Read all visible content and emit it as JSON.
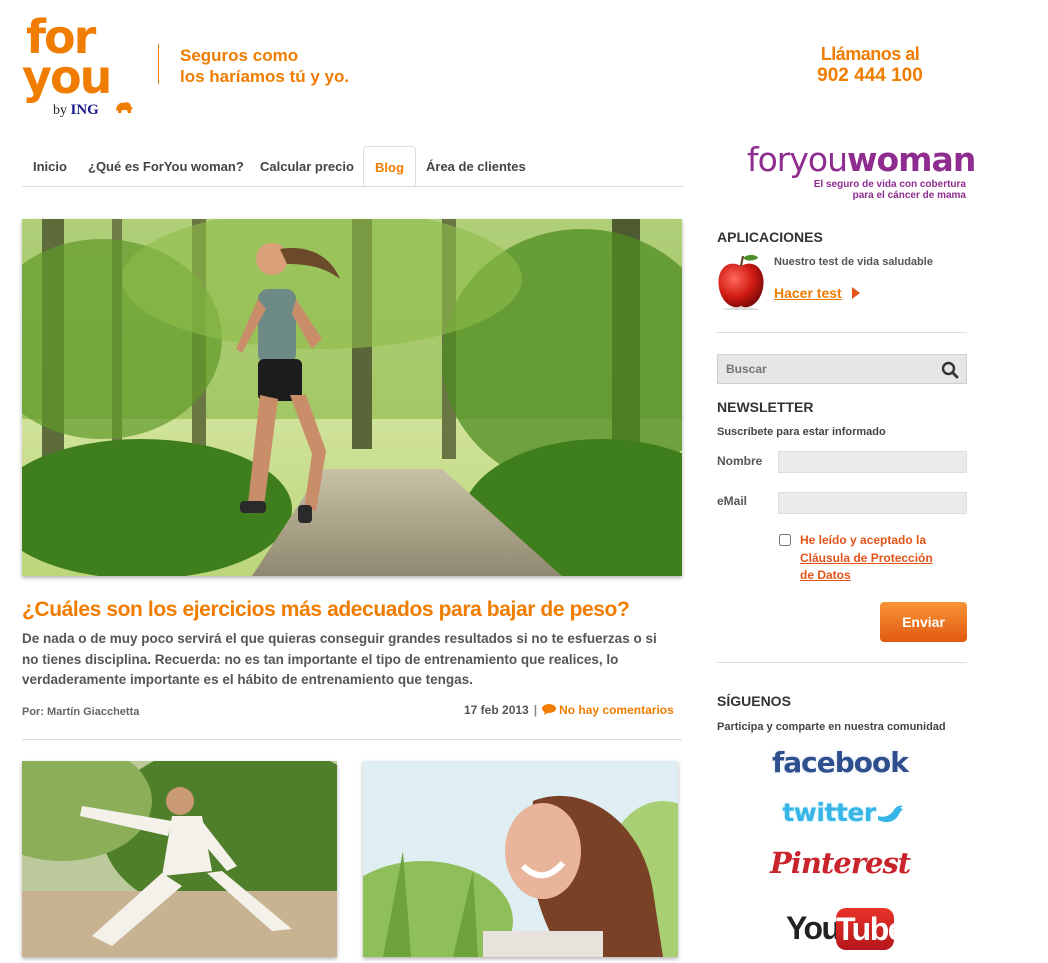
{
  "brand": {
    "logo_line1": "for",
    "logo_line2": "you",
    "logo_by": "by",
    "logo_ing": "ING",
    "tagline_line1": "Seguros como",
    "tagline_line2": "los haríamos tú y yo.",
    "call_label": "Llámanos al",
    "call_number": "902 444 100",
    "product_regular": "foryou",
    "product_bold": "woman",
    "product_sub_line1": "El seguro de vida con cobertura",
    "product_sub_line2": "para el cáncer de mama",
    "orange": "#f07c00",
    "purple": "#8e2d8f"
  },
  "nav": {
    "items": [
      {
        "label": "Inicio",
        "active": false
      },
      {
        "label": "¿Qué es ForYou woman?",
        "active": false
      },
      {
        "label": "Calcular precio",
        "active": false
      },
      {
        "label": "Blog",
        "active": true
      },
      {
        "label": "Área de clientes",
        "active": false
      }
    ]
  },
  "article": {
    "title": "¿Cuáles son los ejercicios más adecuados para bajar de peso?",
    "excerpt": "De nada o de muy poco servirá el que quieras conseguir grandes resultados si no te esfuerzas o si no tienes disciplina. Recuerda: no es tan importante el tipo de entrenamiento que realices, lo verdaderamente importante es el hábito de entrenamiento que tengas.",
    "byline": "Por: Martín Giacchetta",
    "date": "17 feb 2013",
    "separator": "|",
    "comments": "No hay comentarios",
    "image_icon": "woman-running-photo"
  },
  "thumbnails": [
    {
      "icon": "tai-chi-man-photo"
    },
    {
      "icon": "smiling-woman-photo"
    }
  ],
  "sidebar": {
    "apps_heading": "APLICACIONES",
    "apps_desc": "Nuestro test de vida saludable",
    "apps_link": "Hacer test",
    "apps_icon": "apple-icon",
    "search_placeholder": "Buscar",
    "newsletter_heading": "NEWSLETTER",
    "newsletter_desc": "Suscríbete para estar informado",
    "name_label": "Nombre",
    "email_label": "eMail",
    "legal_text": "He leído y aceptado la",
    "legal_link_line1": "Cláusula de Protección",
    "legal_link_line2": "de Datos",
    "submit_label": "Enviar",
    "follow_heading": "SÍGUENOS",
    "follow_desc": "Participa y comparte en nuestra comunidad",
    "social": {
      "facebook": "facebook",
      "twitter": "twitter",
      "pinterest": "Pinterest",
      "youtube_you": "You",
      "youtube_tube": "Tube"
    }
  }
}
